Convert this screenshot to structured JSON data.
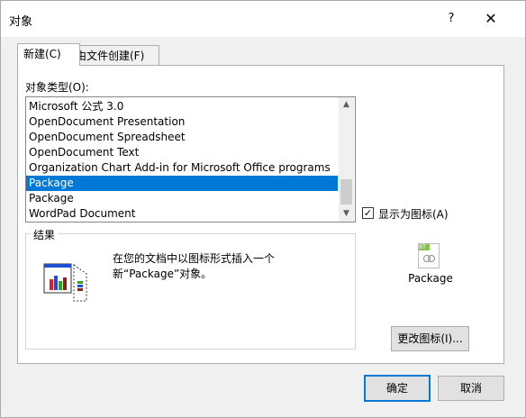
{
  "window": {
    "title": "对象",
    "help_label": "?",
    "close_label": "✕"
  },
  "tabs": [
    {
      "label": "新建(C)",
      "active": true
    },
    {
      "label": "由文件创建(F)",
      "active": false
    }
  ],
  "object_type": {
    "label": "对象类型(O):",
    "items": [
      "Microsoft 公式 3.0",
      "OpenDocument Presentation",
      "OpenDocument Spreadsheet",
      "OpenDocument Text",
      "Organization Chart Add-in for Microsoft Office programs",
      "Package",
      "Package",
      "WordPad Document"
    ],
    "selected_index": 5,
    "scroll_up_icon": "chevron-up-icon",
    "scroll_down_icon": "chevron-down-icon"
  },
  "display_as_icon": {
    "label": "显示为图标(A)",
    "checked": true,
    "check_glyph": "✓"
  },
  "icon_preview": {
    "caption": "Package",
    "icon": "package-icon",
    "tag": "BT"
  },
  "result": {
    "legend": "结果",
    "text": "在您的文档中以图标形式插入一个新“Package”对象。",
    "illustration_icon": "insert-object-illustration"
  },
  "buttons": {
    "change_icon": "更改图标(I)...",
    "ok": "确定",
    "cancel": "取消"
  },
  "colors": {
    "selection": "#0078d7",
    "default_button_border": "#0078d7"
  }
}
